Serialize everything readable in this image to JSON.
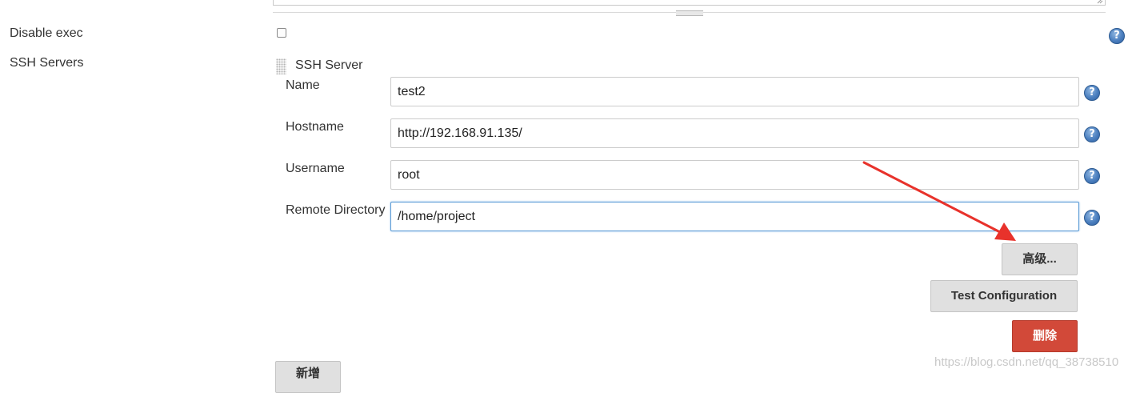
{
  "disable_exec": {
    "label": "Disable exec",
    "checked": false
  },
  "ssh_servers": {
    "section_label": "SSH Servers",
    "server_header": "SSH Server",
    "fields": {
      "name": {
        "label": "Name",
        "value": "test2"
      },
      "hostname": {
        "label": "Hostname",
        "value": "http://192.168.91.135/"
      },
      "username": {
        "label": "Username",
        "value": "root"
      },
      "remote_directory": {
        "label": "Remote Directory",
        "value": "/home/project"
      }
    },
    "advanced_button": "高级...",
    "test_configuration_button": "Test Configuration",
    "delete_button": "删除",
    "add_button": "新增"
  },
  "help_glyph": "?",
  "watermark": "https://blog.csdn.net/qq_38738510",
  "colors": {
    "annotation_arrow": "#e8322b",
    "delete_button": "#d24939",
    "focus_border": "#5b9bd5"
  }
}
